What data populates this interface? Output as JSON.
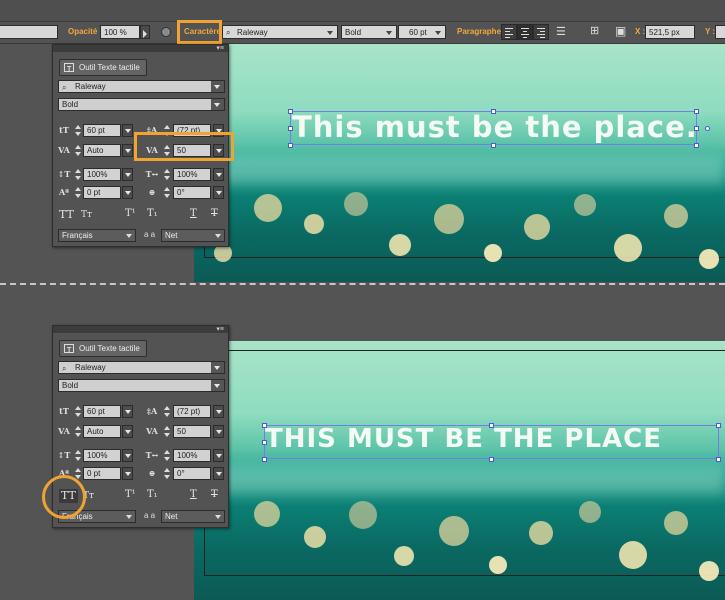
{
  "control_bar": {
    "opacity_label": "Opacité :",
    "opacity_value": "100 %",
    "character_label": "Caractère :",
    "font_family": "Raleway",
    "font_style": "Bold",
    "font_size": "60 pt",
    "paragraph_label": "Paragraphe :",
    "x_label": "X :",
    "x_value": "521,5 px",
    "y_label": "Y :"
  },
  "canvas": {
    "top_headline": "This must be the place.",
    "bottom_headline": "THIS MUST BE THE PLACE"
  },
  "panels": [
    {
      "touch_tool_label": "Outil Texte tactile",
      "font_family": "Raleway",
      "font_style": "Bold",
      "font_size": "60 pt",
      "leading": "(72 pt)",
      "kerning": "Auto",
      "tracking": "50",
      "vertical_scale": "100%",
      "horizontal_scale": "100%",
      "baseline_shift": "0 pt",
      "rotation": "0°",
      "language": "Français",
      "antialias_icon_label": "a a",
      "antialias": "Net"
    },
    {
      "touch_tool_label": "Outil Texte tactile",
      "font_family": "Raleway",
      "font_style": "Bold",
      "font_size": "60 pt",
      "leading": "(72 pt)",
      "kerning": "Auto",
      "tracking": "50",
      "vertical_scale": "100%",
      "horizontal_scale": "100%",
      "baseline_shift": "0 pt",
      "rotation": "0°",
      "language": "Français",
      "antialias_icon_label": "a a",
      "antialias": "Net"
    }
  ],
  "colors": {
    "highlight": "#f0a232",
    "selection": "#4a5ad8",
    "teal_dark": "#0b7f73",
    "mint": "#a8e4c9"
  },
  "icons": [
    "font-search-icon",
    "font-size-icon",
    "leading-icon",
    "kerning-icon",
    "tracking-icon",
    "vertical-scale-icon",
    "horizontal-scale-icon",
    "baseline-shift-icon",
    "rotation-icon",
    "all-caps-icon",
    "small-caps-icon",
    "superscript-icon",
    "subscript-icon",
    "underline-icon",
    "strikethrough-icon",
    "align-left-icon",
    "align-center-icon",
    "align-right-icon"
  ]
}
